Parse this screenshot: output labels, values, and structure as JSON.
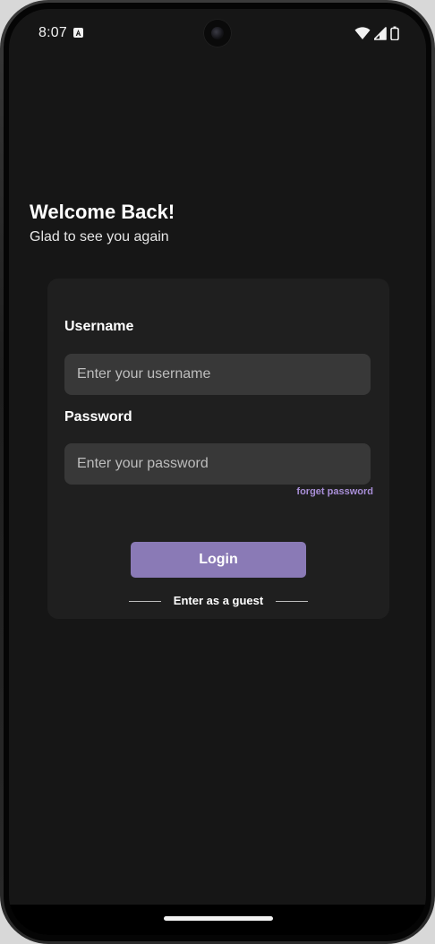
{
  "status_bar": {
    "time": "8:07",
    "left_icons": [
      "a-notification-icon"
    ],
    "right_icons": [
      "wifi-icon",
      "cellular-signal-icon",
      "battery-icon"
    ]
  },
  "welcome": {
    "title": "Welcome Back!",
    "subtitle": "Glad to see you again"
  },
  "form": {
    "username_label": "Username",
    "username_placeholder": "Enter your username",
    "username_value": "",
    "password_label": "Password",
    "password_placeholder": "Enter your password",
    "password_value": "",
    "forget_password": "forget password",
    "login_button": "Login",
    "guest_link": "Enter as a guest"
  },
  "colors": {
    "background": "#161616",
    "card": "#1f1f1f",
    "input": "#383838",
    "accent": "#8a7ab6",
    "link": "#a98fd8"
  }
}
